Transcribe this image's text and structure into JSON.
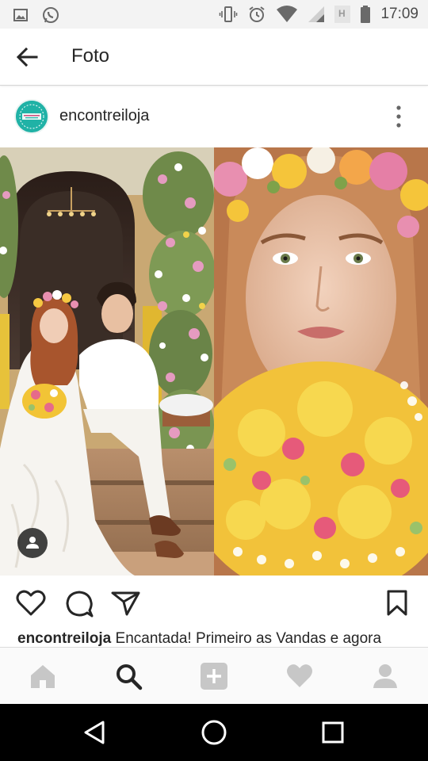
{
  "status_bar": {
    "time": "17:09",
    "icons": [
      "image-icon",
      "whatsapp-icon",
      "vibrate-icon",
      "alarm-icon",
      "wifi-icon",
      "signal-icon",
      "network-h-icon",
      "battery-icon"
    ]
  },
  "app_bar": {
    "title": "Foto",
    "back_icon": "arrow-back-icon"
  },
  "post": {
    "username": "encontreiloja",
    "avatar_label": "Encontrei Loja",
    "more_icon": "more-vertical-icon",
    "photo": {
      "left_panel": "couple-wedding-photo",
      "right_panel": "bride-closeup-photo",
      "tag_icon": "user-tag-icon"
    },
    "actions": {
      "like_icon": "heart-outline-icon",
      "comment_icon": "comment-icon",
      "share_icon": "send-icon",
      "save_icon": "bookmark-icon"
    },
    "caption": {
      "user": "encontreiloja",
      "text": "Encantada! Primeiro as Vandas e agora"
    }
  },
  "bottom_nav": {
    "items": [
      "home-icon",
      "search-icon",
      "add-icon",
      "activity-heart-icon",
      "profile-icon"
    ],
    "active": "search-icon"
  },
  "system_nav": {
    "items": [
      "back-triangle-icon",
      "home-circle-icon",
      "recents-square-icon"
    ]
  },
  "colors": {
    "text": "#262626",
    "nav_icon_inactive": "#c7c7c7",
    "nav_icon_active": "#262626",
    "avatar_bg": "#1aa39a"
  }
}
